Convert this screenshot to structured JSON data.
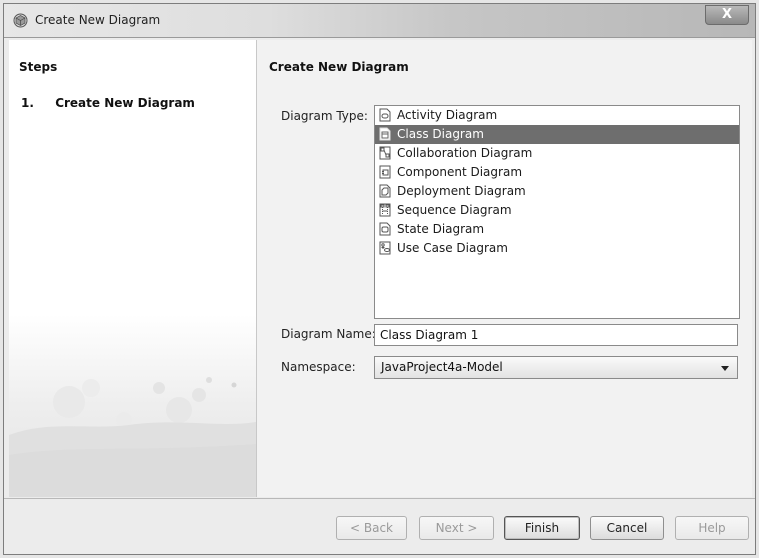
{
  "window": {
    "title": "Create New Diagram",
    "close_label": "X"
  },
  "steps": {
    "heading": "Steps",
    "items": [
      {
        "number": "1.",
        "label": "Create New Diagram"
      }
    ]
  },
  "panel": {
    "title": "Create New Diagram",
    "diagram_type_label": "Diagram Type:",
    "diagram_type_mnemonic": "T",
    "diagram_types": [
      {
        "label": "Activity Diagram",
        "icon": "activity-diagram-icon",
        "selected": false
      },
      {
        "label": "Class Diagram",
        "icon": "class-diagram-icon",
        "selected": true
      },
      {
        "label": "Collaboration Diagram",
        "icon": "collaboration-diagram-icon",
        "selected": false
      },
      {
        "label": "Component Diagram",
        "icon": "component-diagram-icon",
        "selected": false
      },
      {
        "label": "Deployment Diagram",
        "icon": "deployment-diagram-icon",
        "selected": false
      },
      {
        "label": "Sequence Diagram",
        "icon": "sequence-diagram-icon",
        "selected": false
      },
      {
        "label": "State Diagram",
        "icon": "state-diagram-icon",
        "selected": false
      },
      {
        "label": "Use Case Diagram",
        "icon": "use-case-diagram-icon",
        "selected": false
      }
    ],
    "diagram_name_label": "Diagram Name:",
    "diagram_name_value": "Class Diagram 1",
    "namespace_label": "Namespace:",
    "namespace_value": "JavaProject4a-Model"
  },
  "buttons": {
    "back": "< Back",
    "next": "Next >",
    "finish": "Finish",
    "cancel": "Cancel",
    "help": "Help"
  },
  "colors": {
    "selection": "#6e6e6e",
    "window_bg": "#ececec"
  }
}
